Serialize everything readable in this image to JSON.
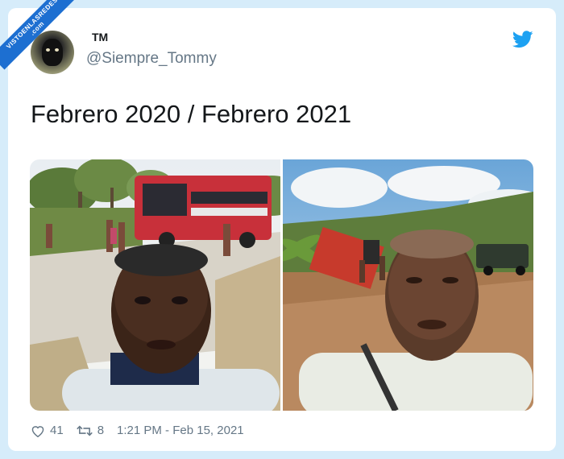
{
  "watermark": {
    "line1": "VISTOENLASREDES",
    "line2": ".com"
  },
  "tweet": {
    "display_name": "TM",
    "handle": "@Siempre_Tommy",
    "text": "Febrero 2020 / Febrero 2021",
    "likes": "41",
    "retweets": "8",
    "timestamp": "1:21 PM - Feb 15, 2021"
  },
  "colors": {
    "accent": "#1da1f2",
    "background": "#d6ecfa",
    "ribbon": "#1d6fd1"
  },
  "icons": [
    "twitter-bird-icon",
    "heart-icon",
    "retweet-icon"
  ]
}
